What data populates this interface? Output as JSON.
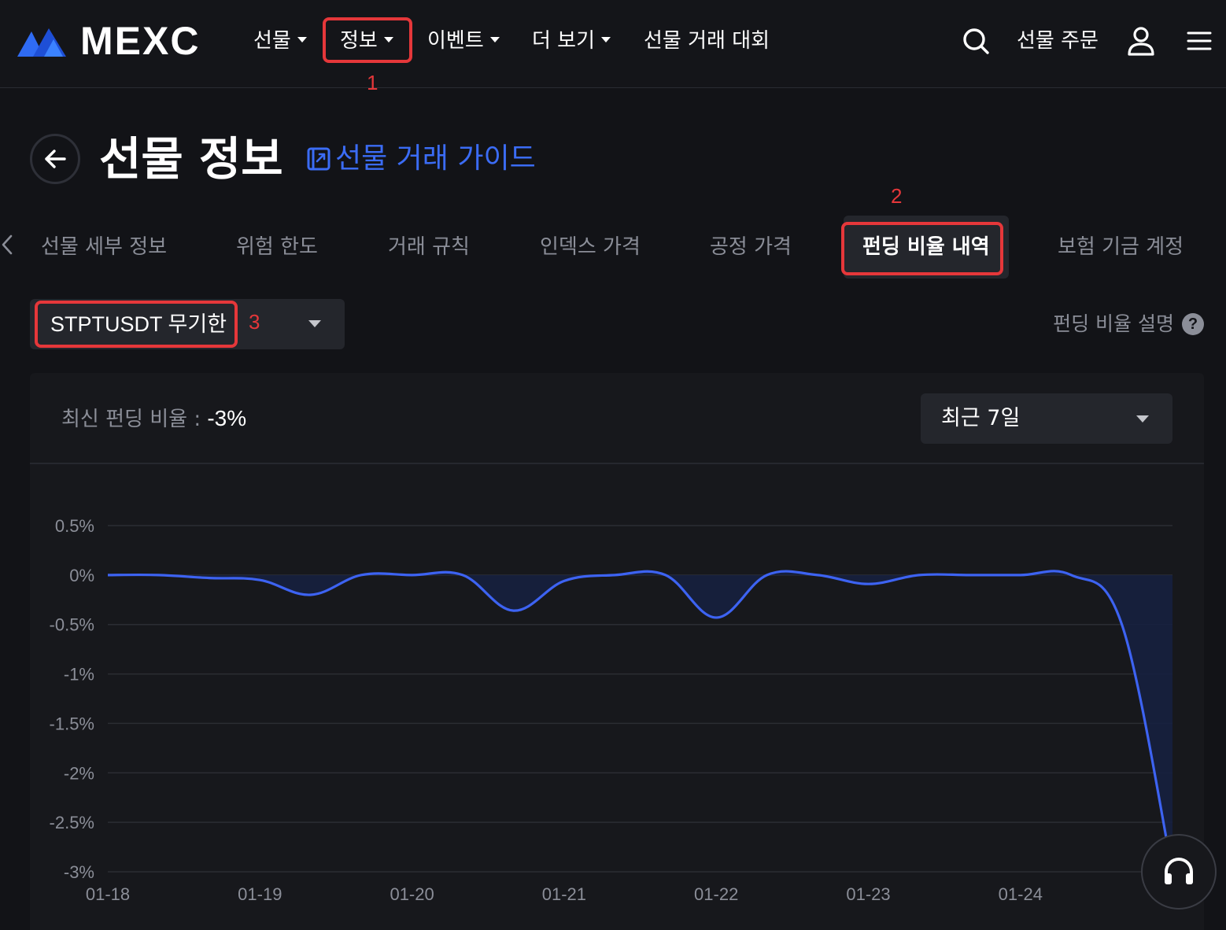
{
  "header": {
    "logo_text": "MEXC",
    "nav": [
      {
        "label": "선물",
        "dropdown": true
      },
      {
        "label": "정보",
        "dropdown": true
      },
      {
        "label": "이벤트",
        "dropdown": true
      },
      {
        "label": "더 보기",
        "dropdown": true
      },
      {
        "label": "선물 거래 대회",
        "dropdown": false
      }
    ],
    "order_label": "선물 주문",
    "icons": [
      "search-icon",
      "user-icon",
      "menu-icon"
    ]
  },
  "annotations": [
    "1",
    "2",
    "3"
  ],
  "page": {
    "title": "선물 정보",
    "guide_link": "선물 거래 가이드"
  },
  "tabs": [
    {
      "label": "선물 세부 정보",
      "active": false
    },
    {
      "label": "위험 한도",
      "active": false
    },
    {
      "label": "거래 규칙",
      "active": false
    },
    {
      "label": "인덱스 가격",
      "active": false
    },
    {
      "label": "공정 가격",
      "active": false
    },
    {
      "label": "펀딩 비율 내역",
      "active": true
    },
    {
      "label": "보험 기금 계정",
      "active": false
    }
  ],
  "symbol_selector": {
    "value": "STPTUSDT 무기한"
  },
  "funding_help": {
    "label": "펀딩 비율 설명",
    "icon": "?"
  },
  "latest_rate": {
    "label": "최신 펀딩 비율 :",
    "value": "-3%"
  },
  "period_selector": {
    "value": "최근 7일"
  },
  "colors": {
    "accent": "#3b6cf5",
    "line": "#3d63f2",
    "annotation": "#e5373a",
    "background": "#121317"
  },
  "chart_data": {
    "type": "area",
    "x_ticks": [
      "01-18",
      "01-19",
      "01-20",
      "01-21",
      "01-22",
      "01-23",
      "01-24"
    ],
    "y_ticks": [
      "0.5%",
      "0%",
      "-0.5%",
      "-1%",
      "-1.5%",
      "-2%",
      "-2.5%",
      "-3%"
    ],
    "ylim": [
      -3,
      0.5
    ],
    "series": [
      {
        "points": [
          {
            "x": "01-18 00:00",
            "y": 0
          },
          {
            "x": "01-18 08:00",
            "y": 0
          },
          {
            "x": "01-18 16:00",
            "y": -0.03
          },
          {
            "x": "01-19 00:00",
            "y": -0.05
          },
          {
            "x": "01-19 08:00",
            "y": -0.2
          },
          {
            "x": "01-19 16:00",
            "y": 0
          },
          {
            "x": "01-20 00:00",
            "y": 0
          },
          {
            "x": "01-20 08:00",
            "y": 0
          },
          {
            "x": "01-20 16:00",
            "y": -0.36
          },
          {
            "x": "01-21 00:00",
            "y": -0.06
          },
          {
            "x": "01-21 08:00",
            "y": 0
          },
          {
            "x": "01-21 16:00",
            "y": 0
          },
          {
            "x": "01-22 00:00",
            "y": -0.43
          },
          {
            "x": "01-22 08:00",
            "y": 0
          },
          {
            "x": "01-22 16:00",
            "y": 0
          },
          {
            "x": "01-23 00:00",
            "y": -0.09
          },
          {
            "x": "01-23 08:00",
            "y": 0
          },
          {
            "x": "01-23 16:00",
            "y": 0
          },
          {
            "x": "01-24 00:00",
            "y": 0
          },
          {
            "x": "01-24 08:00",
            "y": 0
          },
          {
            "x": "01-24 16:00",
            "y": -0.5
          },
          {
            "x": "01-25 00:00",
            "y": -3
          }
        ]
      }
    ],
    "grid": true,
    "legend": false
  }
}
